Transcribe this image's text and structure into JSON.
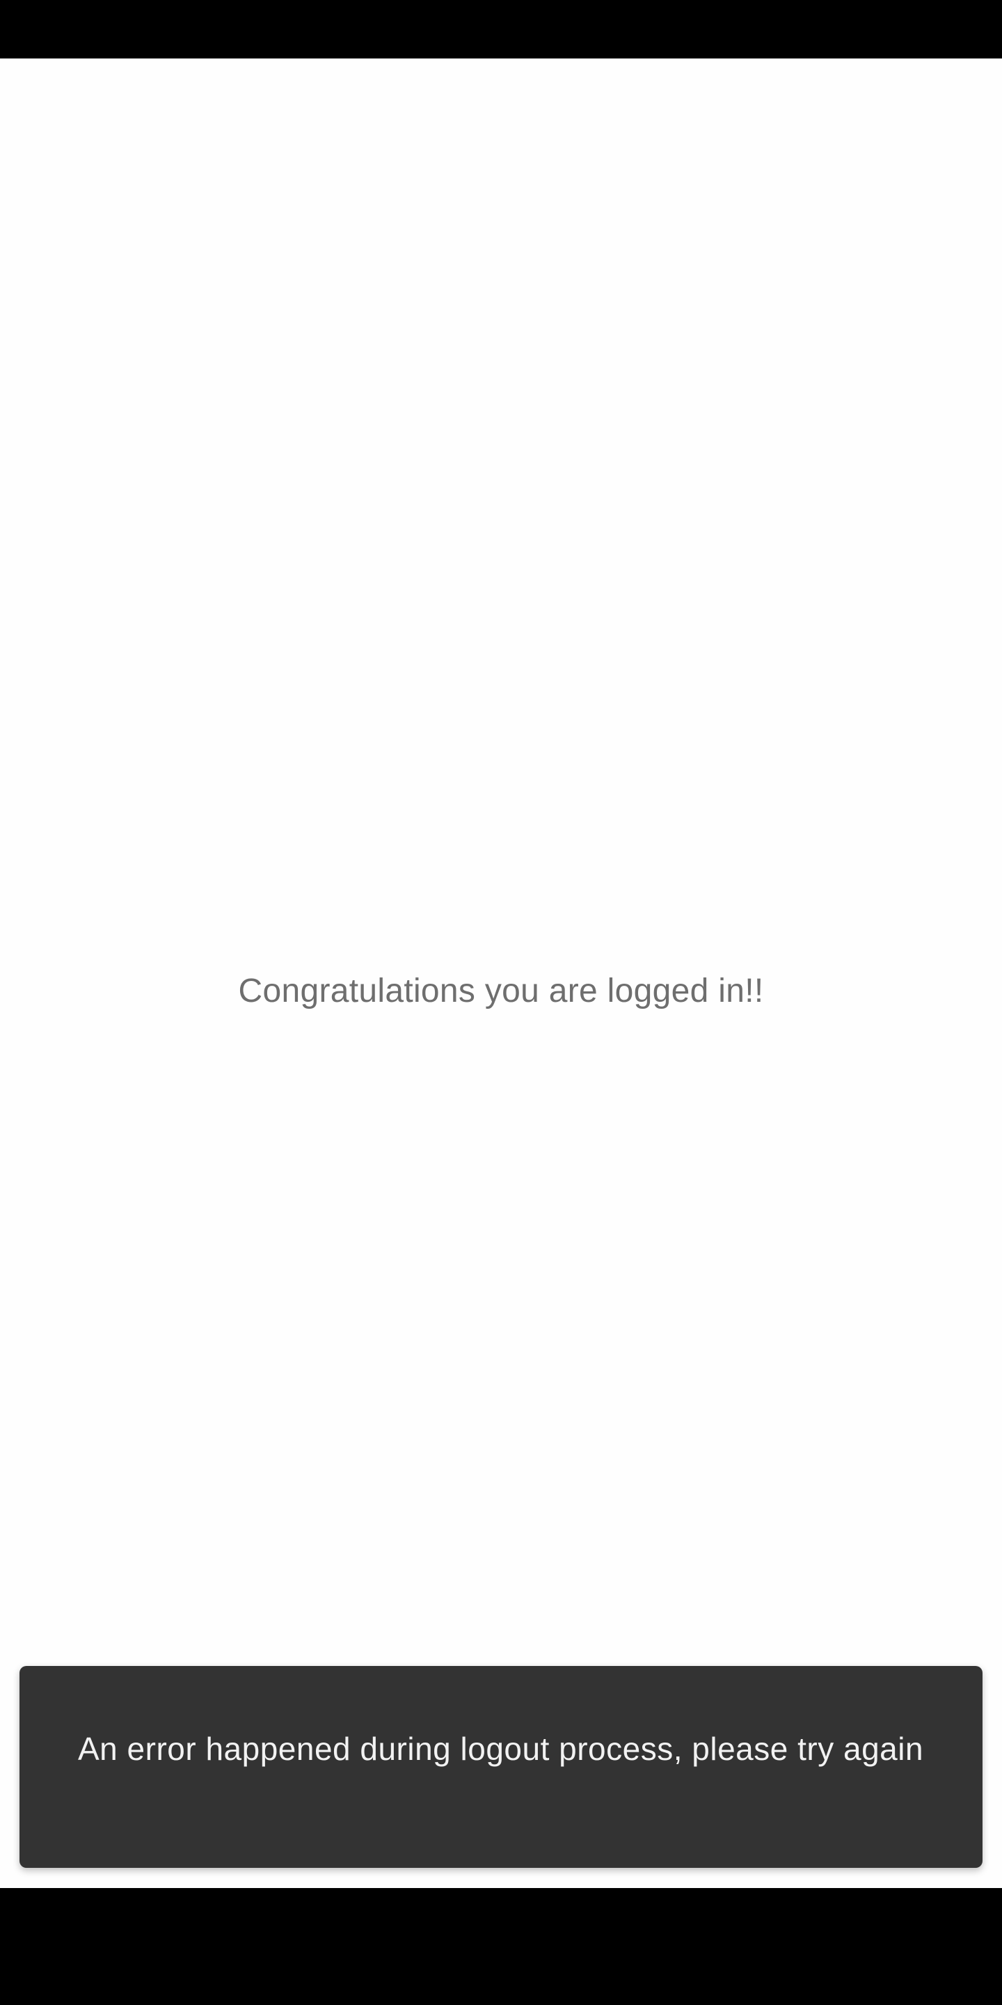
{
  "main": {
    "message": "Congratulations you are logged in!!"
  },
  "snackbar": {
    "text": "An error happened during logout process, please try again"
  },
  "colors": {
    "background": "#fefefe",
    "message_text": "#6e6e6e",
    "snackbar_background": "#333333",
    "snackbar_text": "#f2f2f2",
    "system_bars": "#000000"
  }
}
